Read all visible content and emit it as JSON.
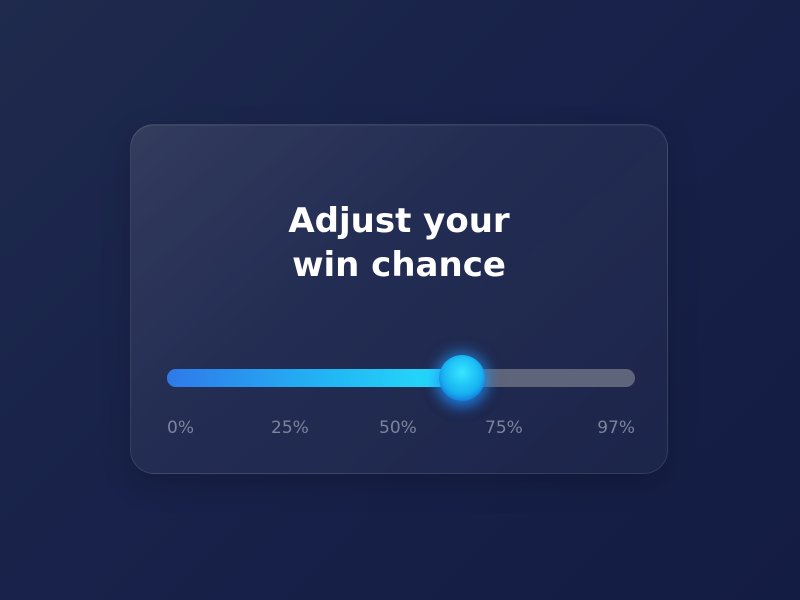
{
  "card": {
    "title_line1": "Adjust your",
    "title_line2": "win chance"
  },
  "slider": {
    "ticks": [
      "0%",
      "25%",
      "50%",
      "75%",
      "97%"
    ],
    "value_fraction": 0.63
  },
  "colors": {
    "background": "#18224a",
    "fill_start": "#2f79ea",
    "fill_end": "#25e2fb",
    "track": "#5e6479",
    "thumb": "#1bbdf5",
    "text": "#ffffff",
    "tick_text": "#7c849c"
  }
}
